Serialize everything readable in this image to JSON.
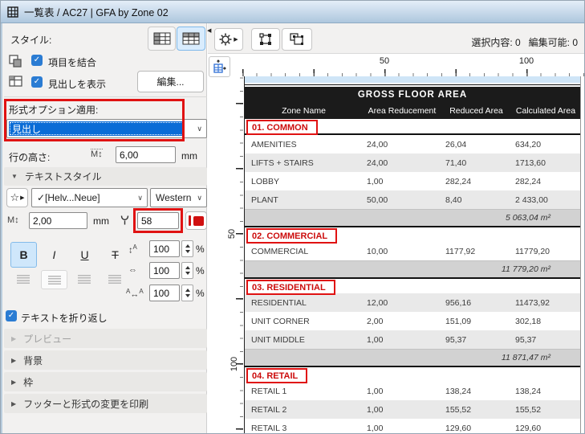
{
  "window": {
    "title": "一覧表 / AC27 | GFA by Zone 02"
  },
  "left_panel": {
    "style_label": "スタイル:",
    "merge_items_label": "項目を結合",
    "show_headers_label": "見出しを表示",
    "edit_button_label": "編集...",
    "format_option_label": "形式オプション適用:",
    "format_option_value": "見出し",
    "row_height_label": "行の高さ:",
    "row_height_value": "6,00",
    "row_height_unit": "mm",
    "text_style_section_label": "テキストスタイル",
    "font_name_value": "✓[Helv...Neue]",
    "font_script_value": "Western",
    "font_size_value": "2,00",
    "font_size_unit": "mm",
    "pen_number_value": "58",
    "bold_label": "B",
    "italic_label": "I",
    "underline_label": "U",
    "strike_label": "T",
    "line_spacing_value": "100",
    "width_factor_value": "100",
    "spacing_value": "100",
    "percent_unit": "%",
    "wrap_text_label": "テキストを折り返し",
    "sections": [
      "プレビュー",
      "背景",
      "枠",
      "フッターと形式の変更を印刷"
    ]
  },
  "toolbar": {
    "selected_info": "選択内容: 0",
    "editable_info": "編集可能: 0"
  },
  "ruler": {
    "h_labels": [
      "50",
      "100"
    ],
    "v_labels": [
      "50",
      "100"
    ]
  },
  "table": {
    "title": "GROSS FLOOR AREA",
    "columns": [
      "Zone Name",
      "Area Reducement",
      "Reduced Area",
      "Calculated Area"
    ],
    "groups": [
      {
        "header": "01. COMMON",
        "rows": [
          [
            "AMENITIES",
            "24,00",
            "26,04",
            "634,20"
          ],
          [
            "LIFTS + STAIRS",
            "24,00",
            "71,40",
            "1713,60"
          ],
          [
            "LOBBY",
            "1,00",
            "282,24",
            "282,24"
          ],
          [
            "PLANT",
            "50,00",
            "8,40",
            "2 433,00"
          ]
        ],
        "subtotal": "5 063,04 m²"
      },
      {
        "header": "02. COMMERCIAL",
        "rows": [
          [
            "COMMERCIAL",
            "10,00",
            "1177,92",
            "11779,20"
          ]
        ],
        "subtotal": "11 779,20 m²"
      },
      {
        "header": "03. RESIDENTIAL",
        "rows": [
          [
            "RESIDENTIAL",
            "12,00",
            "956,16",
            "11473,92"
          ],
          [
            "UNIT CORNER",
            "2,00",
            "151,09",
            "302,18"
          ],
          [
            "UNIT MIDDLE",
            "1,00",
            "95,37",
            "95,37"
          ]
        ],
        "subtotal": "11 871,47 m²"
      },
      {
        "header": "04. RETAIL",
        "rows": [
          [
            "RETAIL 1",
            "1,00",
            "138,24",
            "138,24"
          ],
          [
            "RETAIL 2",
            "1,00",
            "155,52",
            "155,52"
          ],
          [
            "RETAIL 3",
            "1,00",
            "129,60",
            "129,60"
          ]
        ],
        "subtotal": null
      }
    ]
  },
  "colors": {
    "annotation_red": "#e01212",
    "header_text_red": "#cc0c0c",
    "selection_blue": "#0a6cd6",
    "pen_color_red": "#d01010",
    "table_header_black": "#1b1b1b",
    "checkbox_blue": "#2b7cd3"
  }
}
